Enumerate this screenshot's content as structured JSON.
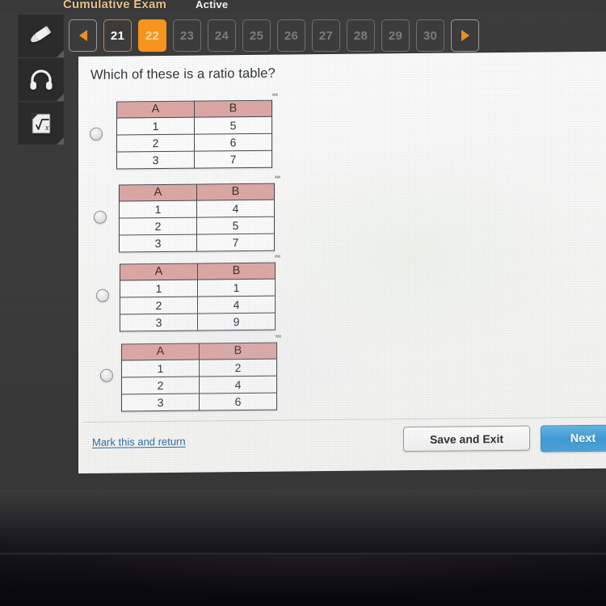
{
  "header": {
    "exam_title": "Cumulative Exam",
    "status": "Active"
  },
  "tools": [
    {
      "name": "highlighter-tool",
      "icon": "highlighter-icon"
    },
    {
      "name": "audio-tool",
      "icon": "headphones-icon"
    },
    {
      "name": "calculator-tool",
      "icon": "calculator-icon"
    }
  ],
  "pager": {
    "prev_label": "◀",
    "next_label": "▶",
    "current": "22",
    "items": [
      {
        "label": "21",
        "state": "answered"
      },
      {
        "label": "22",
        "state": "current"
      },
      {
        "label": "23",
        "state": "future"
      },
      {
        "label": "24",
        "state": "future"
      },
      {
        "label": "25",
        "state": "future"
      },
      {
        "label": "26",
        "state": "future"
      },
      {
        "label": "27",
        "state": "future"
      },
      {
        "label": "28",
        "state": "future"
      },
      {
        "label": "29",
        "state": "future"
      },
      {
        "label": "30",
        "state": "future"
      }
    ]
  },
  "question": {
    "text": "Which of these is a ratio table?",
    "selected": null,
    "options": [
      {
        "id": "option-a",
        "headers": [
          "A",
          "B"
        ],
        "rows": [
          [
            "1",
            "5"
          ],
          [
            "2",
            "6"
          ],
          [
            "3",
            "7"
          ]
        ]
      },
      {
        "id": "option-b",
        "headers": [
          "A",
          "B"
        ],
        "rows": [
          [
            "1",
            "4"
          ],
          [
            "2",
            "5"
          ],
          [
            "3",
            "7"
          ]
        ]
      },
      {
        "id": "option-c",
        "headers": [
          "A",
          "B"
        ],
        "rows": [
          [
            "1",
            "1"
          ],
          [
            "2",
            "4"
          ],
          [
            "3",
            "9"
          ]
        ]
      },
      {
        "id": "option-d",
        "headers": [
          "A",
          "B"
        ],
        "rows": [
          [
            "1",
            "2"
          ],
          [
            "2",
            "4"
          ],
          [
            "3",
            "6"
          ]
        ]
      }
    ]
  },
  "footer": {
    "mark_link": "Mark this and return",
    "save_label": "Save and Exit",
    "next_label": "Next"
  },
  "colors": {
    "accent_orange": "#f6941d",
    "answered_border": "#d4822a",
    "table_header": "#dda7a3",
    "next_blue": "#3e9ad4",
    "link_blue": "#2f6a9e",
    "chrome_dark": "#3a3a3b",
    "title_gold": "#e5c089"
  }
}
